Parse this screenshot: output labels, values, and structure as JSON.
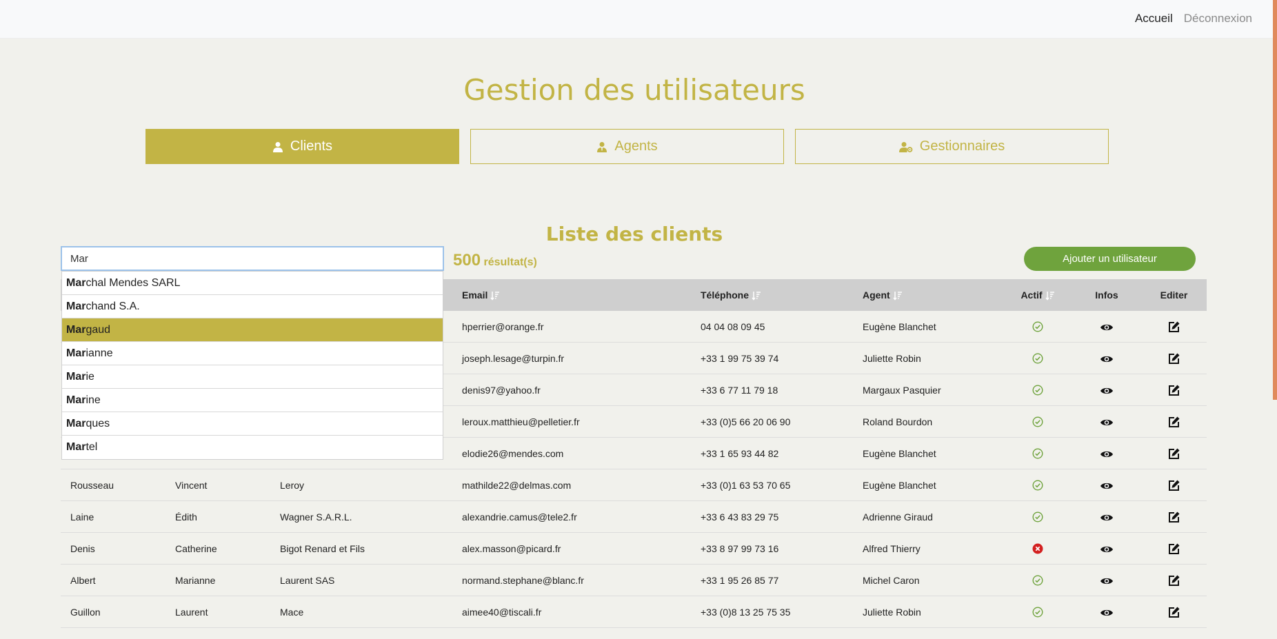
{
  "nav": {
    "home": "Accueil",
    "logout": "Déconnexion"
  },
  "page_title": "Gestion des utilisateurs",
  "tabs": [
    {
      "label": "Clients",
      "icon": "user-icon",
      "active": true
    },
    {
      "label": "Agents",
      "icon": "user-tie-icon",
      "active": false
    },
    {
      "label": "Gestionnaires",
      "icon": "user-gear-icon",
      "active": false
    }
  ],
  "section_title": "Liste des clients",
  "search": {
    "value": "Mar",
    "placeholder": ""
  },
  "results": {
    "count": "500",
    "label": "résultat(s)"
  },
  "add_button": "Ajouter un utilisateur",
  "autocomplete": {
    "items": [
      {
        "match": "Mar",
        "rest": "chal Mendes SARL"
      },
      {
        "match": "Mar",
        "rest": "chand S.A."
      },
      {
        "match": "Mar",
        "rest": "gaud"
      },
      {
        "match": "Mar",
        "rest": "ianne"
      },
      {
        "match": "Mar",
        "rest": "ie"
      },
      {
        "match": "Mar",
        "rest": "ine"
      },
      {
        "match": "Mar",
        "rest": "ques"
      },
      {
        "match": "Mar",
        "rest": "tel"
      }
    ],
    "highlighted_index": 2
  },
  "table": {
    "headers": {
      "email": "Email",
      "phone": "Téléphone",
      "agent": "Agent",
      "active": "Actif",
      "infos": "Infos",
      "edit": "Editer"
    },
    "rows": [
      {
        "nom": "",
        "prenom": "",
        "societe": "",
        "email": "hperrier@orange.fr",
        "phone": "04 04 08 09 45",
        "agent": "Eugène Blanchet",
        "active": true
      },
      {
        "nom": "",
        "prenom": "",
        "societe": "",
        "email": "joseph.lesage@turpin.fr",
        "phone": "+33 1 99 75 39 74",
        "agent": "Juliette Robin",
        "active": true
      },
      {
        "nom": "",
        "prenom": "",
        "societe": "",
        "email": "denis97@yahoo.fr",
        "phone": "+33 6 77 11 79 18",
        "agent": "Margaux Pasquier",
        "active": true
      },
      {
        "nom": "",
        "prenom": "",
        "societe": "",
        "email": "leroux.matthieu@pelletier.fr",
        "phone": "+33 (0)5 66 20 06 90",
        "agent": "Roland Bourdon",
        "active": true
      },
      {
        "nom": "",
        "prenom": "",
        "societe": "",
        "email": "elodie26@mendes.com",
        "phone": "+33 1 65 93 44 82",
        "agent": "Eugène Blanchet",
        "active": true
      },
      {
        "nom": "Rousseau",
        "prenom": "Vincent",
        "societe": "Leroy",
        "email": "mathilde22@delmas.com",
        "phone": "+33 (0)1 63 53 70 65",
        "agent": "Eugène Blanchet",
        "active": true
      },
      {
        "nom": "Laine",
        "prenom": "Édith",
        "societe": "Wagner S.A.R.L.",
        "email": "alexandrie.camus@tele2.fr",
        "phone": "+33 6 43 83 29 75",
        "agent": "Adrienne Giraud",
        "active": true
      },
      {
        "nom": "Denis",
        "prenom": "Catherine",
        "societe": "Bigot Renard et Fils",
        "email": "alex.masson@picard.fr",
        "phone": "+33 8 97 99 73 16",
        "agent": "Alfred Thierry",
        "active": false
      },
      {
        "nom": "Albert",
        "prenom": "Marianne",
        "societe": "Laurent SAS",
        "email": "normand.stephane@blanc.fr",
        "phone": "+33 1 95 26 85 77",
        "agent": "Michel Caron",
        "active": true
      },
      {
        "nom": "Guillon",
        "prenom": "Laurent",
        "societe": "Mace",
        "email": "aimee40@tiscali.fr",
        "phone": "+33 (0)8 13 25 75 35",
        "agent": "Juliette Robin",
        "active": true
      }
    ]
  },
  "colors": {
    "accent": "#c2b445",
    "add_button": "#6fa33d",
    "active_ok": "#6fa33d",
    "inactive": "#d32020",
    "header_bg": "#cfcfcf"
  }
}
